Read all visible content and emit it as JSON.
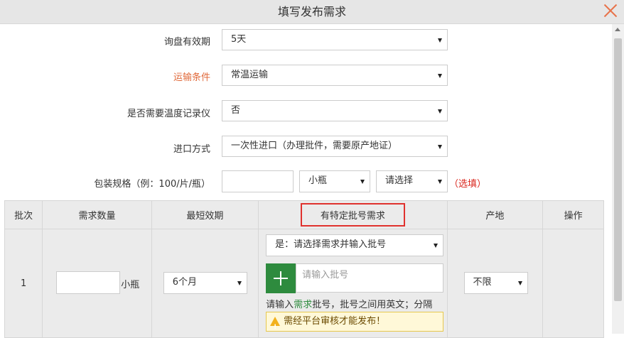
{
  "dialog": {
    "title": "填写发布需求"
  },
  "form": {
    "validity": {
      "label": "询盘有效期",
      "value": "5天"
    },
    "transport": {
      "label": "运输条件",
      "value": "常温运输"
    },
    "temp_recorder": {
      "label": "是否需要温度记录仪",
      "value": "否"
    },
    "import_mode": {
      "label": "进口方式",
      "value": "一次性进口（办理批件，需要原产地证）"
    },
    "packaging": {
      "label": "包装规格（例：100/片/瓶）",
      "unit_value": "小瓶",
      "select_value": "请选择",
      "optional": "（选填）"
    }
  },
  "table": {
    "headers": [
      "批次",
      "需求数量",
      "最短效期",
      "有特定批号需求",
      "产地",
      "操作"
    ],
    "row": {
      "batch": "1",
      "qty_unit": "小瓶",
      "expiry": "6个月",
      "lot_select": "是：请选择需求并输入批号",
      "lot_placeholder": "请输入批号",
      "hint_pre": "请输入",
      "hint_link": "需求",
      "hint_post": "批号，批号之间用英文；分隔",
      "warning": "需经平台审核才能发布！",
      "origin": "不限"
    }
  },
  "colors": {
    "accent_orange": "#e06a3b",
    "highlight_red": "#e0322e",
    "plus_green": "#2e8b3e",
    "link_green": "#2e8b3e"
  }
}
